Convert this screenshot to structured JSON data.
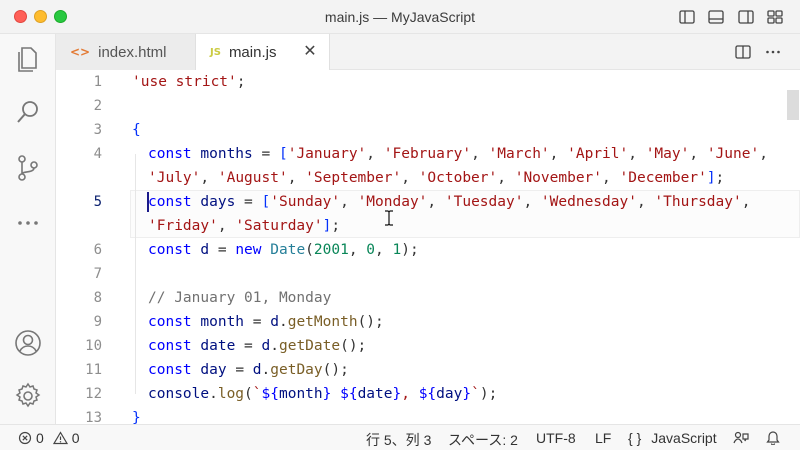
{
  "window": {
    "title": "main.js — MyJavaScript"
  },
  "tabs": [
    {
      "label": "index.html",
      "icon": "html-file-icon"
    },
    {
      "label": "main.js",
      "icon_text": "JS",
      "active": true
    }
  ],
  "editor": {
    "active_line": 5,
    "lines": [
      {
        "n": "1",
        "tokens": [
          [
            "s",
            "'use strict'"
          ],
          [
            "o",
            ";"
          ]
        ]
      },
      {
        "n": "2",
        "tokens": []
      },
      {
        "n": "3",
        "tokens": [
          [
            "b",
            "{"
          ]
        ]
      },
      {
        "n": "4",
        "tokens": [
          [
            "k",
            "const "
          ],
          [
            "v",
            "months"
          ],
          [
            "o",
            " = "
          ],
          [
            "b",
            "["
          ],
          [
            "s",
            "'January'"
          ],
          [
            "o",
            ", "
          ],
          [
            "s",
            "'February'"
          ],
          [
            "o",
            ", "
          ],
          [
            "s",
            "'March'"
          ],
          [
            "o",
            ", "
          ],
          [
            "s",
            "'April'"
          ],
          [
            "o",
            ", "
          ],
          [
            "s",
            "'May'"
          ],
          [
            "o",
            ", "
          ],
          [
            "s",
            "'June'"
          ],
          [
            "o",
            ","
          ]
        ]
      },
      {
        "n": "",
        "tokens": [
          [
            "s",
            "'July'"
          ],
          [
            "o",
            ", "
          ],
          [
            "s",
            "'August'"
          ],
          [
            "o",
            ", "
          ],
          [
            "s",
            "'September'"
          ],
          [
            "o",
            ", "
          ],
          [
            "s",
            "'October'"
          ],
          [
            "o",
            ", "
          ],
          [
            "s",
            "'November'"
          ],
          [
            "o",
            ", "
          ],
          [
            "s",
            "'December'"
          ],
          [
            "b",
            "]"
          ],
          [
            "o",
            ";"
          ]
        ]
      },
      {
        "n": "5",
        "tokens": [
          [
            "k",
            "const "
          ],
          [
            "v",
            "days"
          ],
          [
            "o",
            " = "
          ],
          [
            "b",
            "["
          ],
          [
            "s",
            "'Sunday'"
          ],
          [
            "o",
            ", "
          ],
          [
            "s",
            "'Monday'"
          ],
          [
            "o",
            ", "
          ],
          [
            "s",
            "'Tuesday'"
          ],
          [
            "o",
            ", "
          ],
          [
            "s",
            "'Wednesday'"
          ],
          [
            "o",
            ", "
          ],
          [
            "s",
            "'Thursday'"
          ],
          [
            "o",
            ","
          ]
        ]
      },
      {
        "n": "",
        "tokens": [
          [
            "s",
            "'Friday'"
          ],
          [
            "o",
            ", "
          ],
          [
            "s",
            "'Saturday'"
          ],
          [
            "b",
            "]"
          ],
          [
            "o",
            ";"
          ]
        ]
      },
      {
        "n": "6",
        "tokens": [
          [
            "k",
            "const "
          ],
          [
            "v",
            "d"
          ],
          [
            "o",
            " = "
          ],
          [
            "k",
            "new "
          ],
          [
            "t",
            "Date"
          ],
          [
            "o",
            "("
          ],
          [
            "n",
            "2001"
          ],
          [
            "o",
            ", "
          ],
          [
            "n",
            "0"
          ],
          [
            "o",
            ", "
          ],
          [
            "n",
            "1"
          ],
          [
            "o",
            ");"
          ]
        ]
      },
      {
        "n": "7",
        "tokens": []
      },
      {
        "n": "8",
        "tokens": [
          [
            "c",
            "// January 01, Monday"
          ]
        ]
      },
      {
        "n": "9",
        "tokens": [
          [
            "k",
            "const "
          ],
          [
            "v",
            "month"
          ],
          [
            "o",
            " = "
          ],
          [
            "v",
            "d"
          ],
          [
            "o",
            "."
          ],
          [
            "f",
            "getMonth"
          ],
          [
            "o",
            "();"
          ]
        ]
      },
      {
        "n": "10",
        "tokens": [
          [
            "k",
            "const "
          ],
          [
            "v",
            "date"
          ],
          [
            "o",
            " = "
          ],
          [
            "v",
            "d"
          ],
          [
            "o",
            "."
          ],
          [
            "f",
            "getDate"
          ],
          [
            "o",
            "();"
          ]
        ]
      },
      {
        "n": "11",
        "tokens": [
          [
            "k",
            "const "
          ],
          [
            "v",
            "day"
          ],
          [
            "o",
            " = "
          ],
          [
            "v",
            "d"
          ],
          [
            "o",
            "."
          ],
          [
            "f",
            "getDay"
          ],
          [
            "o",
            "();"
          ]
        ]
      },
      {
        "n": "12",
        "tokens": [
          [
            "v",
            "console"
          ],
          [
            "o",
            "."
          ],
          [
            "f",
            "log"
          ],
          [
            "o",
            "("
          ],
          [
            "s",
            "`"
          ],
          [
            "k",
            "${"
          ],
          [
            "v",
            "month"
          ],
          [
            "k",
            "}"
          ],
          [
            "s",
            " "
          ],
          [
            "k",
            "${"
          ],
          [
            "v",
            "date"
          ],
          [
            "k",
            "}"
          ],
          [
            "s",
            ", "
          ],
          [
            "k",
            "${"
          ],
          [
            "v",
            "day"
          ],
          [
            "k",
            "}"
          ],
          [
            "s",
            "`"
          ],
          [
            "o",
            ");"
          ]
        ]
      },
      {
        "n": "13",
        "tokens": [
          [
            "b",
            "}"
          ]
        ]
      }
    ]
  },
  "statusbar": {
    "errors": "0",
    "warnings": "0",
    "position": "行 5、列 3",
    "spaces": "スペース: 2",
    "encoding": "UTF-8",
    "eol": "LF",
    "language_braces": "{ }",
    "language": "JavaScript"
  },
  "colors": {
    "keyword": "#0000ff",
    "variable": "#001080",
    "string": "#a31515",
    "number": "#098658",
    "function": "#795e26",
    "comment": "#717171"
  }
}
